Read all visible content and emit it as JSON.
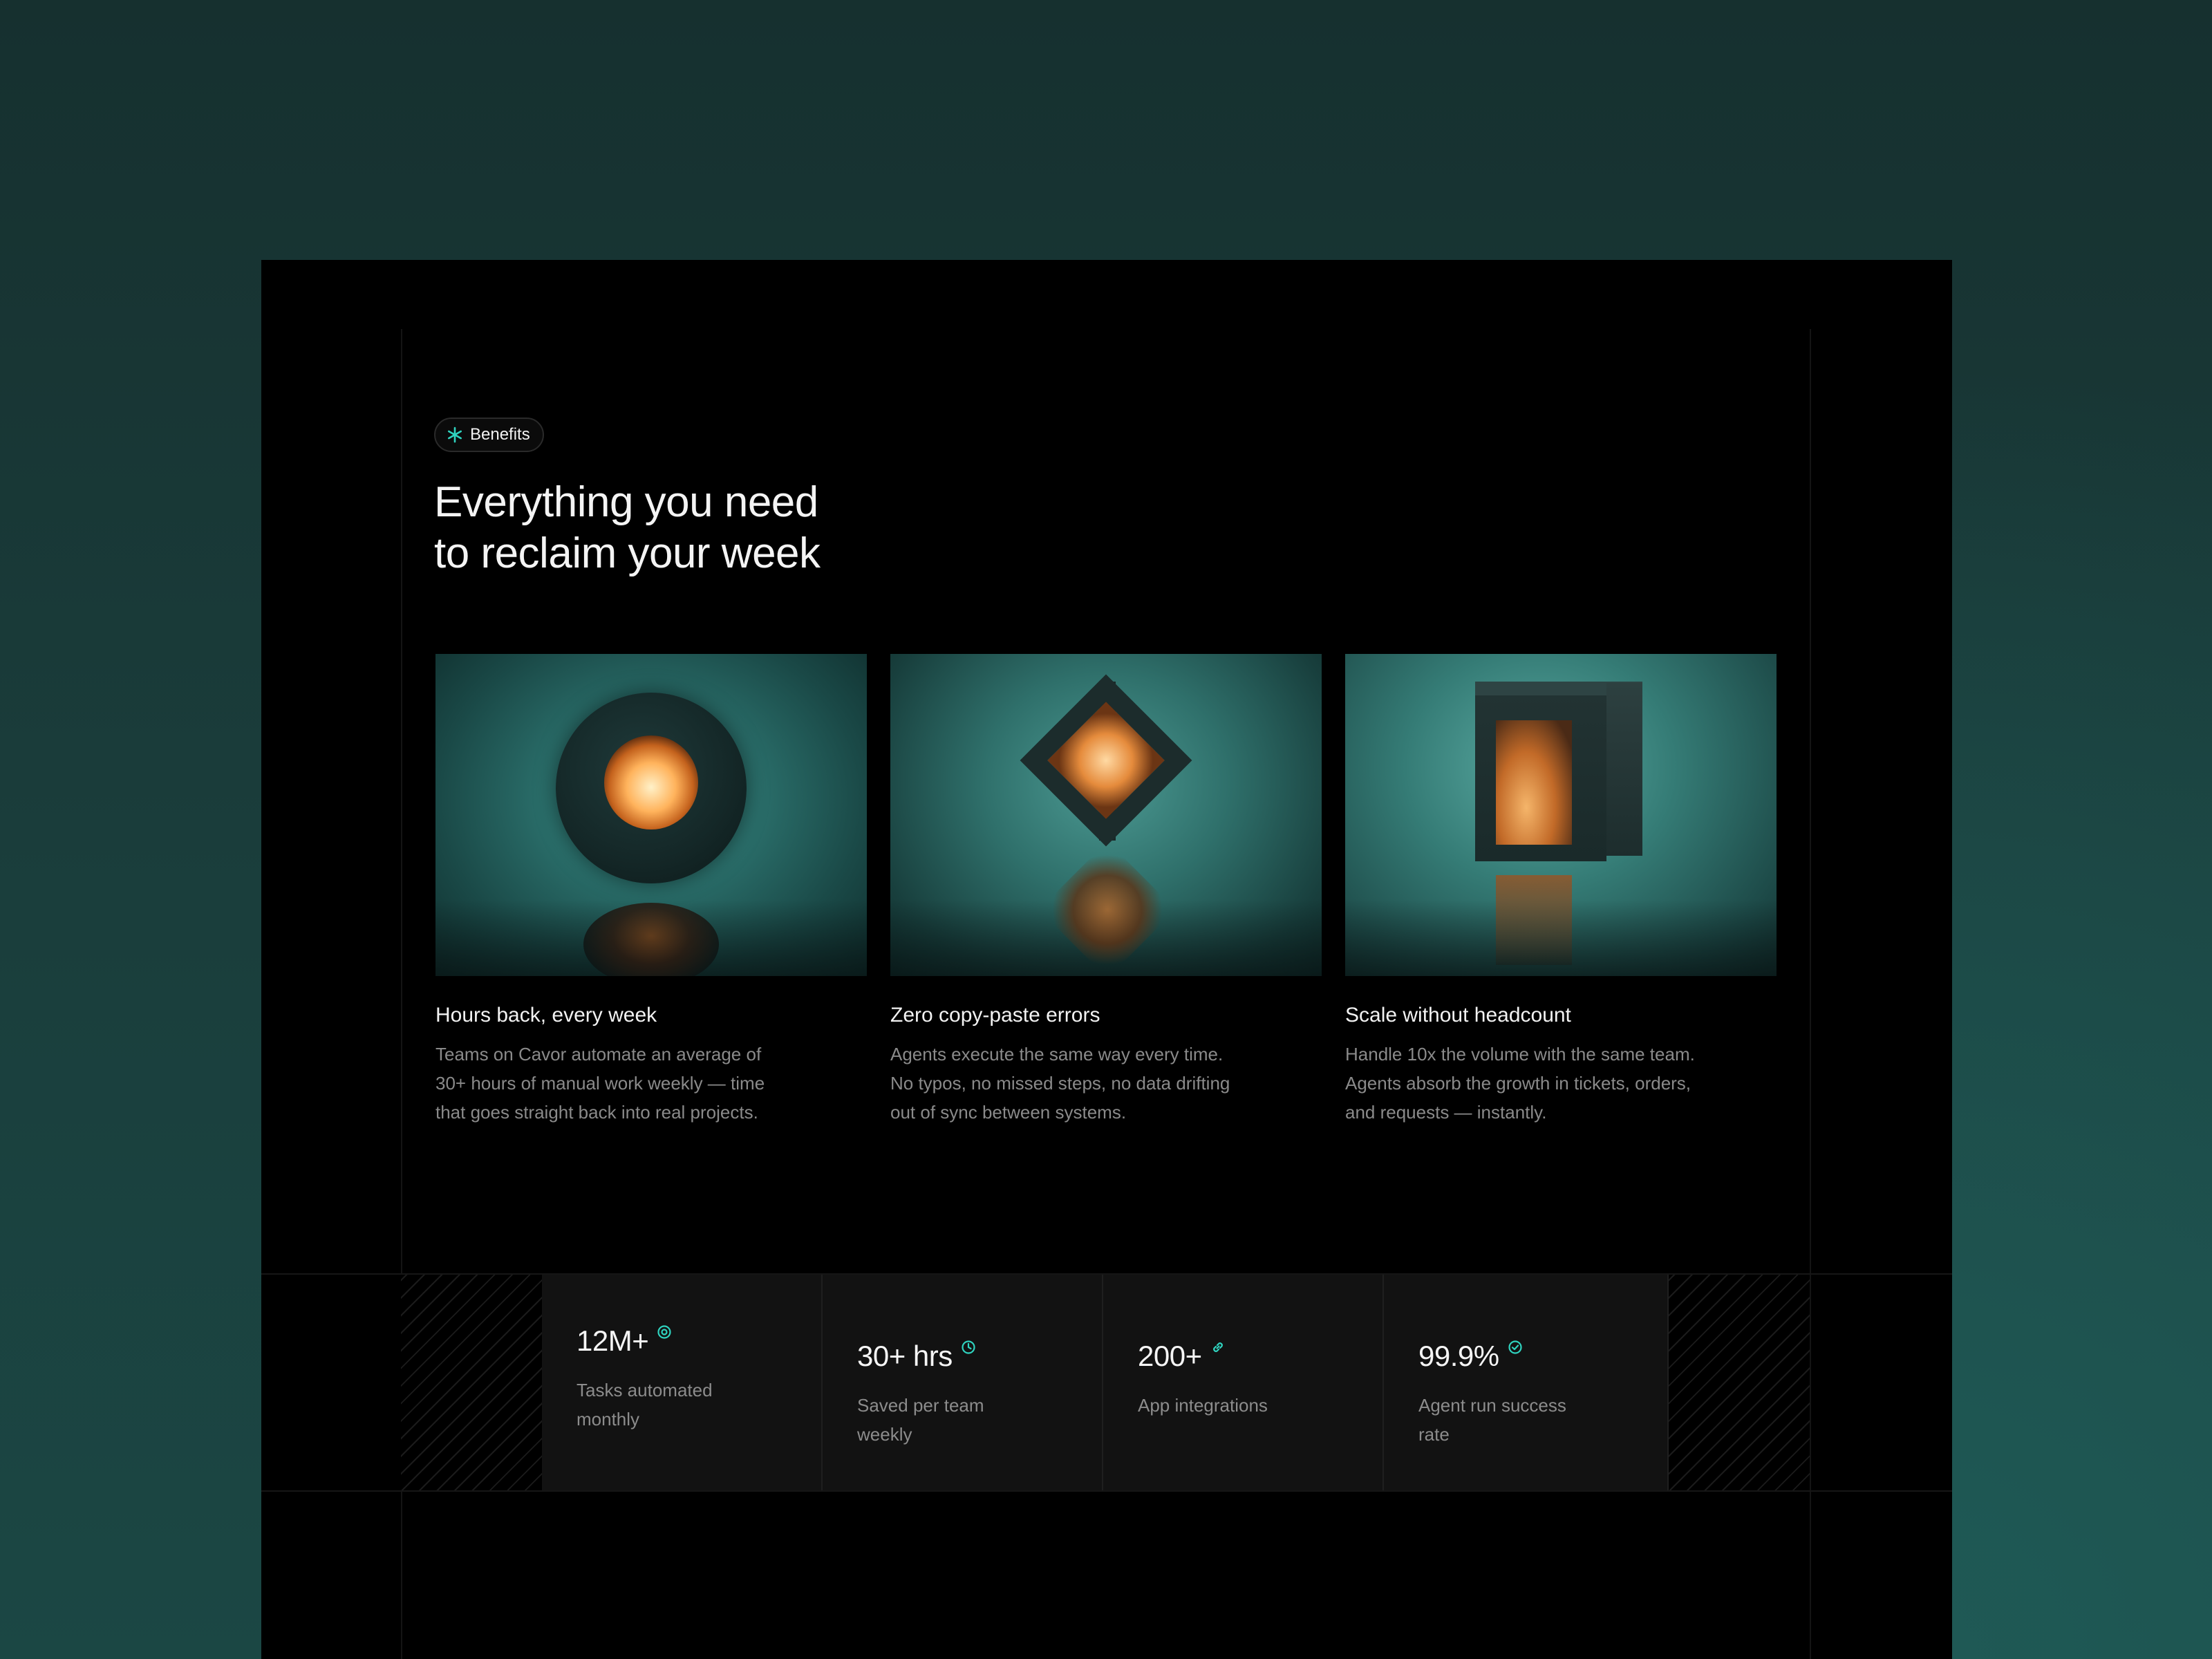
{
  "badge": {
    "label": "Benefits",
    "icon": "asterisk-icon"
  },
  "headline": {
    "line1": "Everything you need",
    "line2": "to reclaim your week"
  },
  "cards": [
    {
      "title": "Hours back, every week",
      "description": "Teams on Cavor automate an average of 30+ hours of manual work weekly — time that goes straight back into real projects."
    },
    {
      "title": "Zero copy-paste errors",
      "description": "Agents execute the same way every time. No typos, no missed steps, no data drifting out of sync between systems."
    },
    {
      "title": "Scale without headcount",
      "description": "Handle 10x the volume with the same team. Agents absorb the growth in tickets, orders, and requests — instantly."
    }
  ],
  "stats": [
    {
      "value": "12M+",
      "label": "Tasks automated monthly",
      "icon": "target-icon"
    },
    {
      "value": "30+ hrs",
      "label": "Saved per team weekly",
      "icon": "clock-icon"
    },
    {
      "value": "200+",
      "label": "App integrations",
      "icon": "link-icon"
    },
    {
      "value": "99.9%",
      "label": "Agent run success rate",
      "icon": "check-circle-icon"
    }
  ],
  "colors": {
    "accent": "#2fd3bf",
    "background": "#000000",
    "muted_text": "#8a8a8a"
  }
}
